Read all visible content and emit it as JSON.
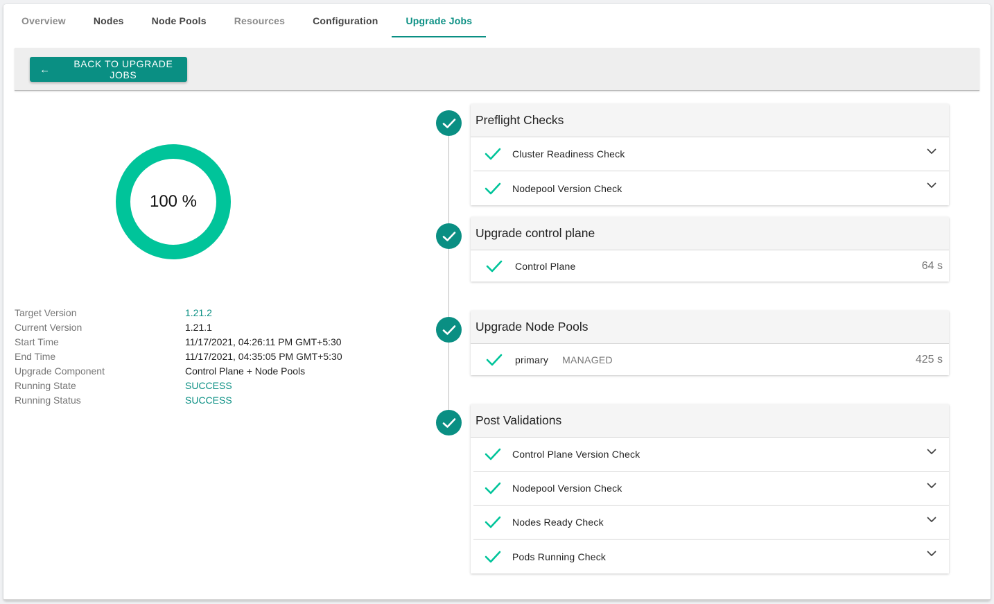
{
  "tabs": [
    {
      "label": "Overview",
      "state": "muted"
    },
    {
      "label": "Nodes",
      "state": "normal"
    },
    {
      "label": "Node Pools",
      "state": "normal"
    },
    {
      "label": "Resources",
      "state": "muted"
    },
    {
      "label": "Configuration",
      "state": "normal"
    },
    {
      "label": "Upgrade Jobs",
      "state": "active"
    }
  ],
  "toolbar": {
    "back_label": "BACK TO UPGRADE JOBS",
    "back_icon": "arrow-left-icon"
  },
  "progress": {
    "percent": 100,
    "label": "100 %",
    "color": "#00c49a"
  },
  "details": [
    {
      "label": "Target Version",
      "value": "1.21.2",
      "teal": true
    },
    {
      "label": "Current Version",
      "value": "1.21.1",
      "teal": false
    },
    {
      "label": "Start Time",
      "value": "11/17/2021, 04:26:11 PM GMT+5:30",
      "teal": false
    },
    {
      "label": "End Time",
      "value": "11/17/2021, 04:35:05 PM GMT+5:30",
      "teal": false
    },
    {
      "label": "Upgrade Component",
      "value": "Control Plane + Node Pools",
      "teal": false
    },
    {
      "label": "Running State",
      "value": "SUCCESS",
      "teal": true
    },
    {
      "label": "Running Status",
      "value": "SUCCESS",
      "teal": true
    }
  ],
  "stages": {
    "preflight": {
      "title": "Preflight Checks",
      "checks": [
        "Cluster Readiness Check",
        "Nodepool Version Check"
      ]
    },
    "control_plane": {
      "title": "Upgrade control plane",
      "item": {
        "label": "Control Plane",
        "duration": "64 s"
      }
    },
    "node_pools": {
      "title": "Upgrade Node Pools",
      "item": {
        "label": "primary",
        "tag": "MANAGED",
        "duration": "425 s"
      }
    },
    "post": {
      "title": "Post Validations",
      "checks": [
        "Control Plane Version Check",
        "Nodepool Version Check",
        "Nodes Ready Check",
        "Pods Running Check"
      ]
    }
  },
  "colors": {
    "primary": "#0a8f83",
    "check": "#00c49a",
    "muted": "#757575"
  }
}
